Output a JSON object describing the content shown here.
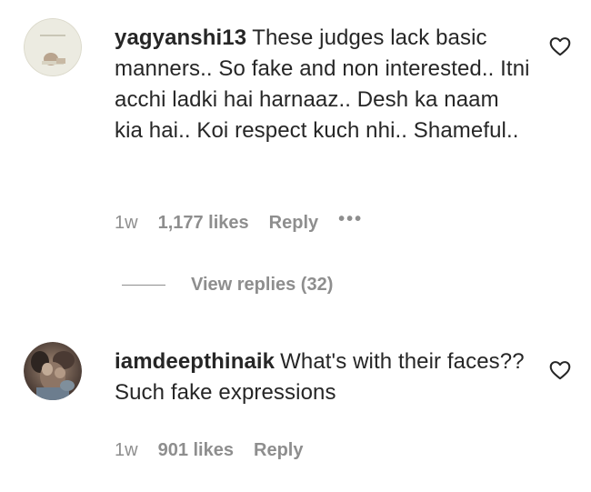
{
  "comments": [
    {
      "username": "yagyanshi13",
      "text": "These judges lack basic manners.. So fake and non interested.. Itni acchi ladki hai harnaaz.. Desh ka naam kia hai.. Koi respect kuch nhi.. Shameful..",
      "time": "1w",
      "likes": "1,177 likes",
      "reply_label": "Reply",
      "more_label": "•••",
      "view_replies": "View replies (32)"
    },
    {
      "username": "iamdeepthinaik",
      "text": "What's with their faces?? Such fake expressions",
      "time": "1w",
      "likes": "901 likes",
      "reply_label": "Reply"
    }
  ],
  "icons": {
    "like": "heart-outline-icon",
    "more": "more-options-icon"
  },
  "colors": {
    "text": "#262626",
    "secondary": "#8e8e8e",
    "background": "#ffffff"
  }
}
